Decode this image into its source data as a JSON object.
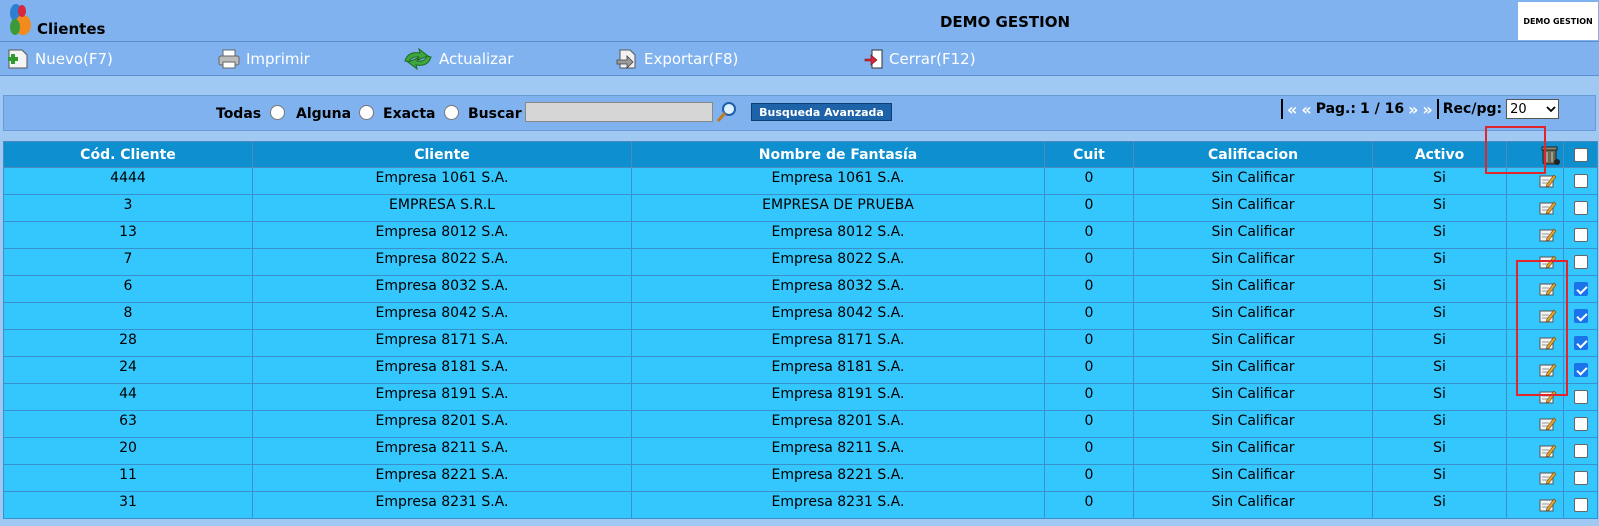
{
  "app": {
    "title": "Clientes",
    "center_title": "DEMO GESTION",
    "brand": "DEMO GESTION"
  },
  "toolbar": {
    "new_label": "Nuevo(F7)",
    "print_label": "Imprimir",
    "refresh_label": "Actualizar",
    "export_label": "Exportar(F8)",
    "close_label": "Cerrar(F12)"
  },
  "search": {
    "opt_all": "Todas",
    "opt_any": "Alguna",
    "opt_exact": "Exacta",
    "label": "Buscar",
    "value": "",
    "advanced_label": "Busqueda Avanzada"
  },
  "pager": {
    "first": "«",
    "prev": "«",
    "page_label": "Pag.:",
    "page_value": "1 / 16",
    "next": "»",
    "last": "»",
    "recpg_label": "Rec/pg:",
    "recpg_value": "20"
  },
  "table": {
    "headers": [
      "Cód. Cliente",
      "Cliente",
      "Nombre de Fantasía",
      "Cuit",
      "Calificacion",
      "Activo"
    ],
    "rows": [
      {
        "code": "4444",
        "cliente": "Empresa 1061 S.A.",
        "fantasia": "Empresa 1061 S.A.",
        "cuit": "0",
        "calif": "Sin Calificar",
        "activo": "Si",
        "checked": false
      },
      {
        "code": "3",
        "cliente": "EMPRESA S.R.L",
        "fantasia": "EMPRESA DE PRUEBA",
        "cuit": "0",
        "calif": "Sin Calificar",
        "activo": "Si",
        "checked": false
      },
      {
        "code": "13",
        "cliente": "Empresa 8012 S.A.",
        "fantasia": "Empresa 8012 S.A.",
        "cuit": "0",
        "calif": "Sin Calificar",
        "activo": "Si",
        "checked": false
      },
      {
        "code": "7",
        "cliente": "Empresa 8022 S.A.",
        "fantasia": "Empresa 8022 S.A.",
        "cuit": "0",
        "calif": "Sin Calificar",
        "activo": "Si",
        "checked": false
      },
      {
        "code": "6",
        "cliente": "Empresa 8032 S.A.",
        "fantasia": "Empresa 8032 S.A.",
        "cuit": "0",
        "calif": "Sin Calificar",
        "activo": "Si",
        "checked": true
      },
      {
        "code": "8",
        "cliente": "Empresa 8042 S.A.",
        "fantasia": "Empresa 8042 S.A.",
        "cuit": "0",
        "calif": "Sin Calificar",
        "activo": "Si",
        "checked": true
      },
      {
        "code": "28",
        "cliente": "Empresa 8171 S.A.",
        "fantasia": "Empresa 8171 S.A.",
        "cuit": "0",
        "calif": "Sin Calificar",
        "activo": "Si",
        "checked": true
      },
      {
        "code": "24",
        "cliente": "Empresa 8181 S.A.",
        "fantasia": "Empresa 8181 S.A.",
        "cuit": "0",
        "calif": "Sin Calificar",
        "activo": "Si",
        "checked": true
      },
      {
        "code": "44",
        "cliente": "Empresa 8191 S.A.",
        "fantasia": "Empresa 8191 S.A.",
        "cuit": "0",
        "calif": "Sin Calificar",
        "activo": "Si",
        "checked": false
      },
      {
        "code": "63",
        "cliente": "Empresa 8201 S.A.",
        "fantasia": "Empresa 8201 S.A.",
        "cuit": "0",
        "calif": "Sin Calificar",
        "activo": "Si",
        "checked": false
      },
      {
        "code": "20",
        "cliente": "Empresa 8211 S.A.",
        "fantasia": "Empresa 8211 S.A.",
        "cuit": "0",
        "calif": "Sin Calificar",
        "activo": "Si",
        "checked": false
      },
      {
        "code": "11",
        "cliente": "Empresa 8221 S.A.",
        "fantasia": "Empresa 8221 S.A.",
        "cuit": "0",
        "calif": "Sin Calificar",
        "activo": "Si",
        "checked": false
      },
      {
        "code": "31",
        "cliente": "Empresa 8231 S.A.",
        "fantasia": "Empresa 8231 S.A.",
        "cuit": "0",
        "calif": "Sin Calificar",
        "activo": "Si",
        "checked": false
      }
    ]
  },
  "icons": {
    "logo": "app-logo-icon",
    "new": "new-document-icon",
    "print": "printer-icon",
    "refresh": "refresh-icon",
    "export": "export-icon",
    "close": "exit-door-icon",
    "search": "magnifier-icon",
    "delete": "trash-can-icon",
    "edit": "edit-pencil-icon"
  },
  "colors": {
    "header_bg": "#0e8fd0",
    "row_bg": "#33c7fd",
    "bar_bg": "#7fb2ee",
    "highlight": "#e0252b"
  }
}
